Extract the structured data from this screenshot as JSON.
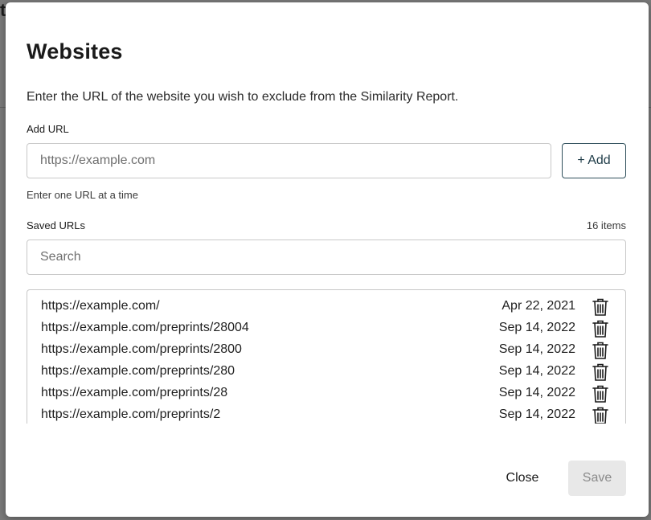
{
  "modal": {
    "title": "Websites",
    "description": "Enter the URL of the website you wish to exclude from the Similarity Report.",
    "add_url_label": "Add URL",
    "url_placeholder": "https://example.com",
    "add_button": "+ Add",
    "hint": "Enter one URL at a time",
    "saved_label": "Saved URLs",
    "count": "16 items",
    "search_placeholder": "Search",
    "close_button": "Close",
    "save_button": "Save"
  },
  "saved_urls": [
    {
      "url": "https://example.com/",
      "date": "Apr 22, 2021"
    },
    {
      "url": "https://example.com/preprints/28004",
      "date": "Sep 14, 2022"
    },
    {
      "url": "https://example.com/preprints/2800",
      "date": "Sep 14, 2022"
    },
    {
      "url": "https://example.com/preprints/280",
      "date": "Sep 14, 2022"
    },
    {
      "url": "https://example.com/preprints/28",
      "date": "Sep 14, 2022"
    },
    {
      "url": "https://example.com/preprints/2",
      "date": "Sep 14, 2022"
    }
  ],
  "icons": {
    "delete": "trash-icon"
  },
  "colors": {
    "accent": "#2f4f5b",
    "overlay": "#707070",
    "disabled_bg": "#e8e8e8"
  }
}
